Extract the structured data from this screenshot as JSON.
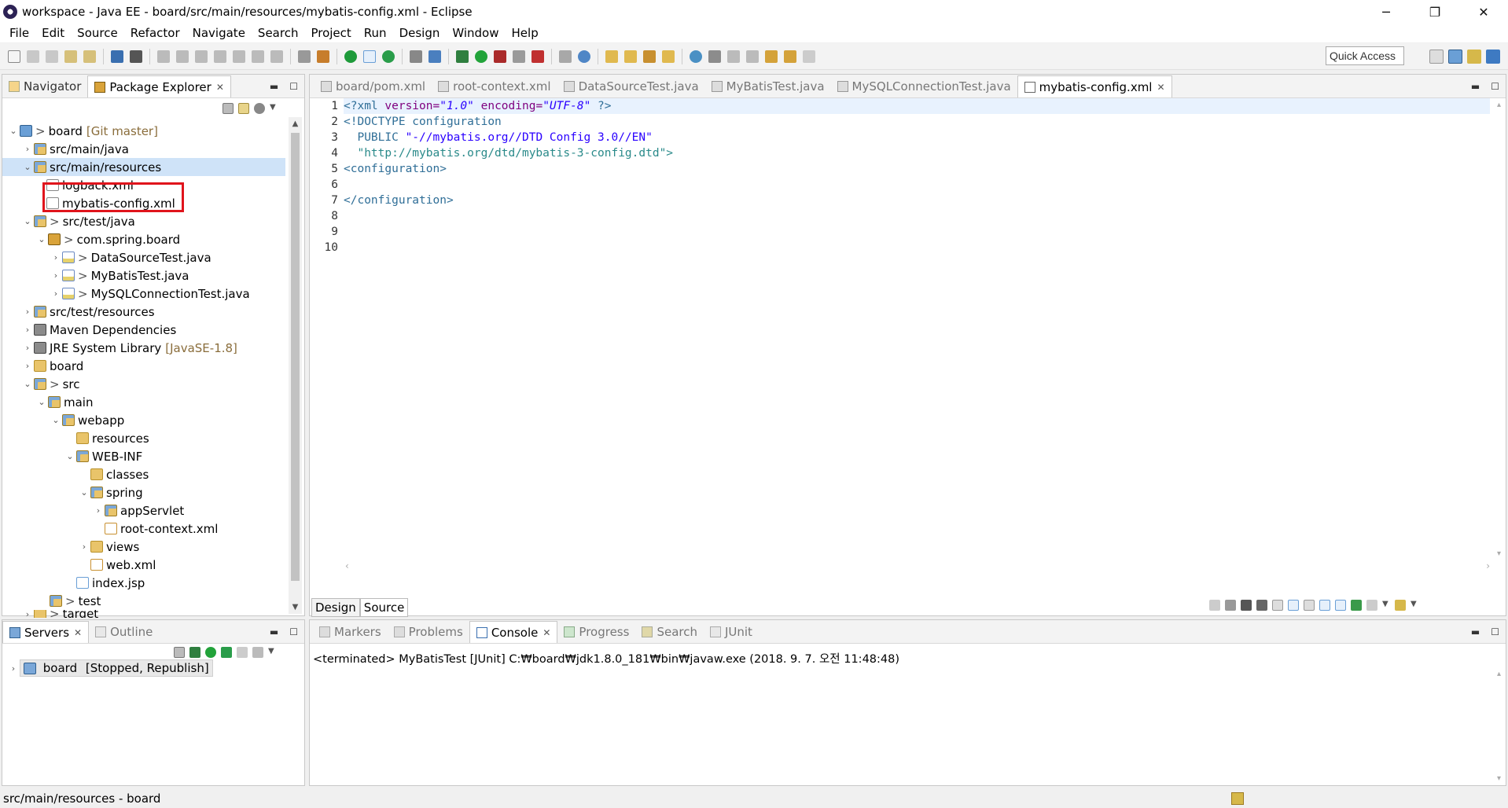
{
  "window": {
    "title": "workspace - Java EE - board/src/main/resources/mybatis-config.xml - Eclipse",
    "controls": [
      "─",
      "❐",
      "✕"
    ]
  },
  "menu": [
    "File",
    "Edit",
    "Source",
    "Refactor",
    "Navigate",
    "Search",
    "Project",
    "Run",
    "Design",
    "Window",
    "Help"
  ],
  "toolbar": {
    "quick_access": "Quick Access"
  },
  "left_panel": {
    "tabs": [
      {
        "label": "Navigator",
        "active": false
      },
      {
        "label": "Package Explorer",
        "active": true
      }
    ],
    "tree": [
      {
        "label": "board",
        "extra": "[Git master]",
        "prefix": ">",
        "arrow": "v"
      },
      {
        "label": "src/main/java",
        "arrow": ">"
      },
      {
        "label": "src/main/resources",
        "arrow": "v"
      },
      {
        "label": "logback.xml"
      },
      {
        "label": "mybatis-config.xml"
      },
      {
        "label": "src/test/java",
        "prefix": ">",
        "arrow": "v"
      },
      {
        "label": "com.spring.board",
        "prefix": ">",
        "arrow": "v"
      },
      {
        "label": "DataSourceTest.java",
        "prefix": ">",
        "arrow": ">"
      },
      {
        "label": "MyBatisTest.java",
        "prefix": ">",
        "arrow": ">"
      },
      {
        "label": "MySQLConnectionTest.java",
        "prefix": ">",
        "arrow": ">"
      },
      {
        "label": "src/test/resources",
        "arrow": ">"
      },
      {
        "label": "Maven Dependencies",
        "arrow": ">"
      },
      {
        "label": "JRE System Library",
        "extra": "[JavaSE-1.8]",
        "arrow": ">"
      },
      {
        "label": "board",
        "arrow": ">"
      },
      {
        "label": "src",
        "prefix": ">",
        "arrow": "v"
      },
      {
        "label": "main",
        "arrow": "v"
      },
      {
        "label": "webapp",
        "arrow": "v"
      },
      {
        "label": "resources"
      },
      {
        "label": "WEB-INF",
        "arrow": "v"
      },
      {
        "label": "classes"
      },
      {
        "label": "spring",
        "arrow": "v"
      },
      {
        "label": "appServlet",
        "arrow": ">"
      },
      {
        "label": "root-context.xml"
      },
      {
        "label": "views",
        "arrow": ">"
      },
      {
        "label": "web.xml"
      },
      {
        "label": "index.jsp"
      },
      {
        "label": "test",
        "prefix": ">"
      },
      {
        "label": "target",
        "prefix": ">"
      }
    ]
  },
  "editor": {
    "tabs": [
      {
        "label": "board/pom.xml"
      },
      {
        "label": "root-context.xml"
      },
      {
        "label": "DataSourceTest.java"
      },
      {
        "label": "MyBatisTest.java"
      },
      {
        "label": "MySQLConnectionTest.java"
      },
      {
        "label": "mybatis-config.xml",
        "active": true
      }
    ],
    "line_numbers": [
      "1",
      "2",
      "3",
      "4",
      "5",
      "6",
      "7",
      "8",
      "9",
      "10"
    ],
    "code": {
      "l1_open": "<?xml ",
      "l1_attr1": "version=",
      "l1_val1": "\"1.0\"",
      "l1_attr2": " encoding=",
      "l1_val2": "\"UTF-8\"",
      "l1_close": " ?>",
      "l2": "<!DOCTYPE configuration",
      "l3_kw": "  PUBLIC ",
      "l3_str": "\"-//mybatis.org//DTD Config 3.0//EN\"",
      "l4": "  \"http://mybatis.org/dtd/mybatis-3-config.dtd\">",
      "l5": "<configuration>",
      "l7": "</configuration>"
    },
    "bottom_tabs": [
      "Design",
      "Source"
    ]
  },
  "servers_panel": {
    "tabs": [
      {
        "label": "Servers",
        "active": true
      },
      {
        "label": "Outline",
        "active": false
      }
    ],
    "server": {
      "name": "board",
      "state": "[Stopped, Republish]"
    }
  },
  "console_panel": {
    "tabs": [
      {
        "label": "Markers"
      },
      {
        "label": "Problems"
      },
      {
        "label": "Console",
        "active": true
      },
      {
        "label": "Progress"
      },
      {
        "label": "Search"
      },
      {
        "label": "JUnit"
      }
    ],
    "output": "<terminated> MyBatisTest [JUnit] C:₩board₩jdk1.8.0_181₩bin₩javaw.exe (2018. 9. 7. 오전 11:48:48)"
  },
  "status_bar": {
    "text": "src/main/resources - board"
  }
}
